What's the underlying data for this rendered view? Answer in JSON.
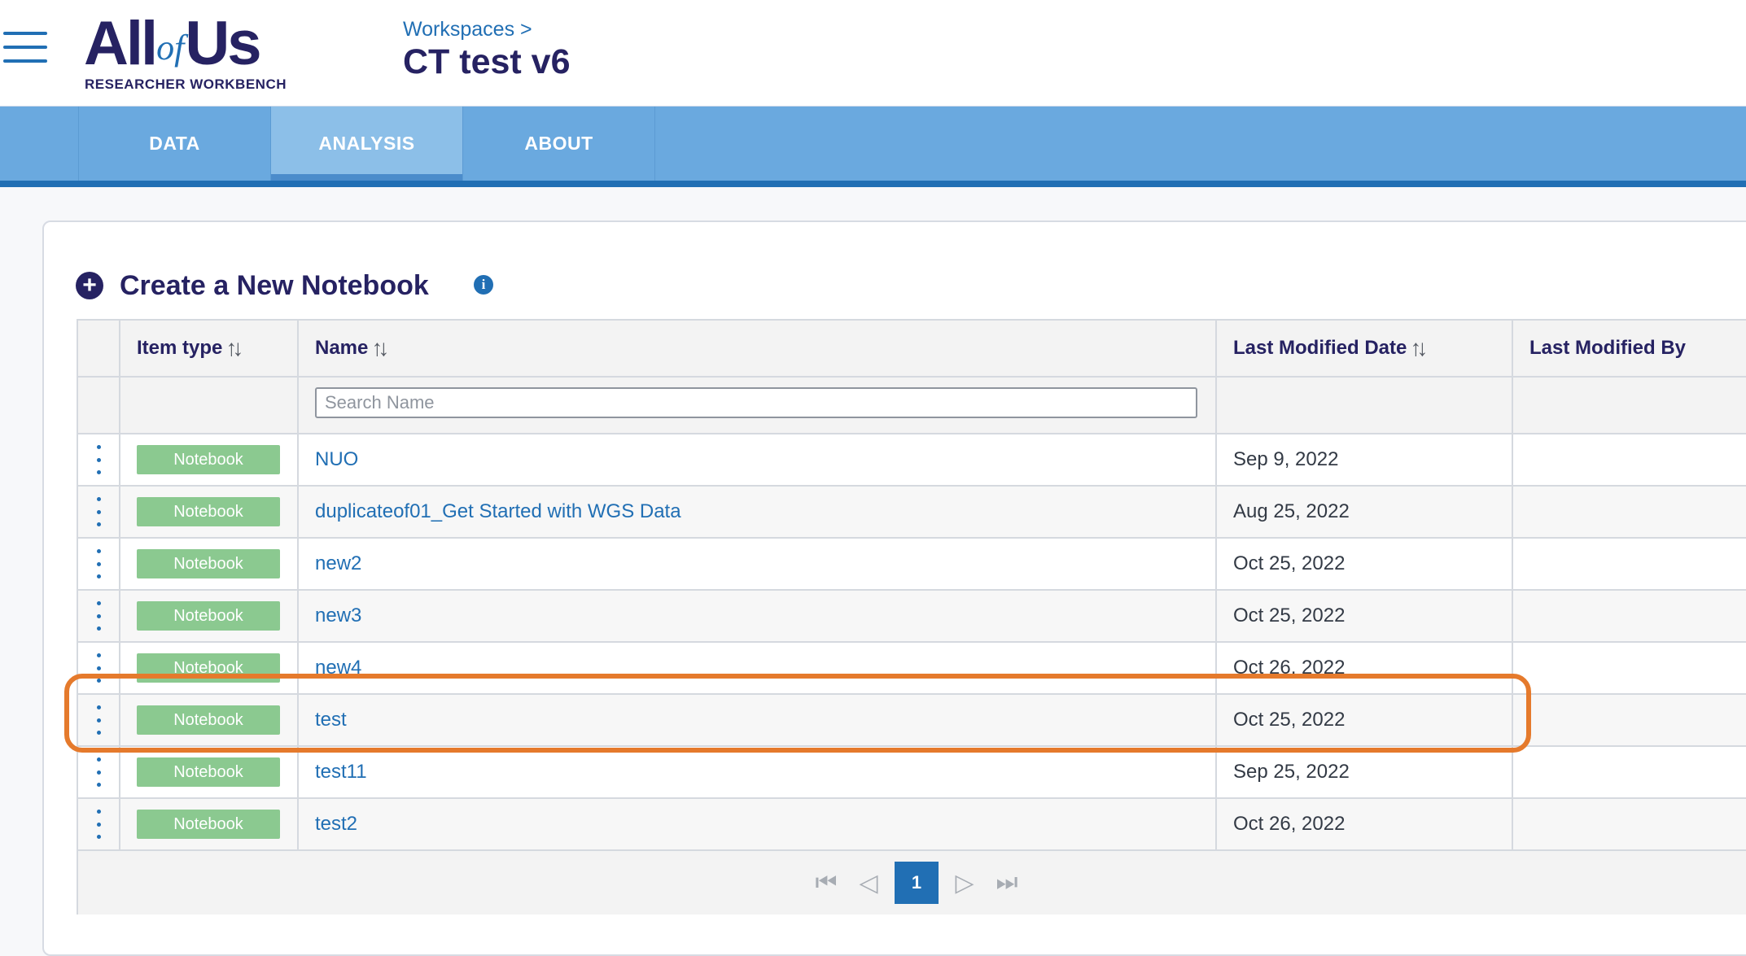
{
  "app": {
    "logo_word_start": "All",
    "logo_word_of": "of",
    "logo_word_end": "Us",
    "logo_subtitle": "RESEARCHER WORKBENCH"
  },
  "breadcrumb": {
    "label": "Workspaces >"
  },
  "workspace": {
    "title": "CT test v6"
  },
  "tabs": [
    {
      "label": "DATA",
      "active": false
    },
    {
      "label": "ANALYSIS",
      "active": true
    },
    {
      "label": "ABOUT",
      "active": false
    }
  ],
  "create": {
    "label": "Create a New Notebook",
    "icon": "plus-circle-icon",
    "info_icon": "info-icon"
  },
  "table": {
    "columns": {
      "item_type": "Item type",
      "name": "Name",
      "last_modified_date": "Last Modified Date",
      "last_modified_by": "Last Modified By"
    },
    "sort_glyph": "↑↓",
    "search_placeholder": "Search Name",
    "rows": [
      {
        "type": "Notebook",
        "name": "NUO",
        "date": "Sep 9, 2022",
        "by": ""
      },
      {
        "type": "Notebook",
        "name": "duplicateof01_Get Started with WGS Data",
        "date": "Aug 25, 2022",
        "by": ""
      },
      {
        "type": "Notebook",
        "name": "new2",
        "date": "Oct 25, 2022",
        "by": ""
      },
      {
        "type": "Notebook",
        "name": "new3",
        "date": "Oct 25, 2022",
        "by": ""
      },
      {
        "type": "Notebook",
        "name": "new4",
        "date": "Oct 26, 2022",
        "by": ""
      },
      {
        "type": "Notebook",
        "name": "test",
        "date": "Oct 25, 2022",
        "by": ""
      },
      {
        "type": "Notebook",
        "name": "test11",
        "date": "Sep 25, 2022",
        "by": ""
      },
      {
        "type": "Notebook",
        "name": "test2",
        "date": "Oct 26, 2022",
        "by": ""
      }
    ],
    "pager": {
      "current_page": "1"
    }
  },
  "colors": {
    "navy": "#262262",
    "blue": "#216fb4",
    "tab_bar": "#6aa9df",
    "badge_green": "#8bc990",
    "highlight_orange": "#e57a2c"
  }
}
